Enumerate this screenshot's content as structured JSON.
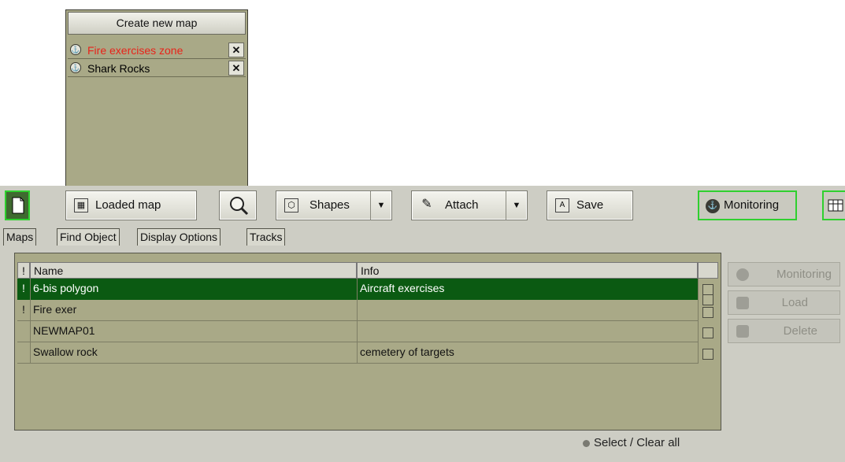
{
  "popup": {
    "create_label": "Create new map",
    "maps": [
      {
        "name": "Fire exercises zone",
        "color": "#e8231a"
      },
      {
        "name": "Shark Rocks",
        "color": "#111111"
      }
    ]
  },
  "toolbar": {
    "loaded_map_label": "Loaded map",
    "shapes_label": "Shapes",
    "attach_label": "Attach",
    "save_label": "Save",
    "monitoring_label": "Monitoring"
  },
  "tabs": [
    "Maps",
    "Find Object",
    "Display Options",
    "Tracks"
  ],
  "table": {
    "columns": [
      "!",
      "Name",
      "Info"
    ],
    "rows": [
      {
        "flag": "!",
        "name": "6-bis polygon",
        "info": "Aircraft exercises",
        "selected": true
      },
      {
        "flag": "!",
        "name": "Fire exer",
        "info": "",
        "selected": false
      },
      {
        "flag": "",
        "name": "NEWMAP01",
        "info": "",
        "selected": false
      },
      {
        "flag": "",
        "name": "Swallow rock",
        "info": "cemetery of targets",
        "selected": false
      }
    ],
    "select_all_label": "Select / Clear all"
  },
  "side_buttons": {
    "monitoring_label": "Monitoring",
    "load_label": "Load",
    "delete_label": "Delete"
  },
  "colors": {
    "selected_row": "#0b5a12",
    "active_button_border": "#2fd02f",
    "panel_olive": "#a9a987"
  }
}
